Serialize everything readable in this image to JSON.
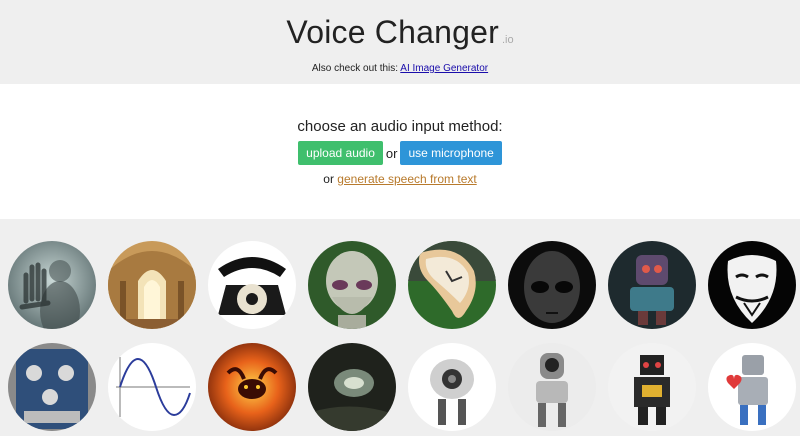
{
  "header": {
    "title": "Voice Changer",
    "title_suffix": ".io",
    "also_text": "Also check out this: ",
    "also_link": "AI Image Generator"
  },
  "input": {
    "prompt": "choose an audio input method:",
    "upload_label": "upload audio",
    "or_1": "or",
    "mic_label": "use microphone",
    "or_2": "or",
    "tts_label": "generate speech from text"
  },
  "colors": {
    "upload_button": "#3fbf6d",
    "mic_button": "#2e95d8",
    "tts_link": "#b87a2c",
    "link": "#1a0dab"
  },
  "voices": [
    {
      "icon": "ghost-hand-icon"
    },
    {
      "icon": "cathedral-icon"
    },
    {
      "icon": "telephone-icon"
    },
    {
      "icon": "alien-icon"
    },
    {
      "icon": "melting-clock-icon"
    },
    {
      "icon": "dark-alien-icon"
    },
    {
      "icon": "colorful-robot-icon"
    },
    {
      "icon": "anonymous-mask-icon"
    },
    {
      "icon": "guitar-pedal-icon"
    },
    {
      "icon": "sine-wave-icon"
    },
    {
      "icon": "balrog-fire-icon"
    },
    {
      "icon": "cave-icon"
    },
    {
      "icon": "white-robot-icon"
    },
    {
      "icon": "chrome-robot-icon"
    },
    {
      "icon": "toy-robot-icon"
    },
    {
      "icon": "tin-robot-heart-icon"
    }
  ]
}
